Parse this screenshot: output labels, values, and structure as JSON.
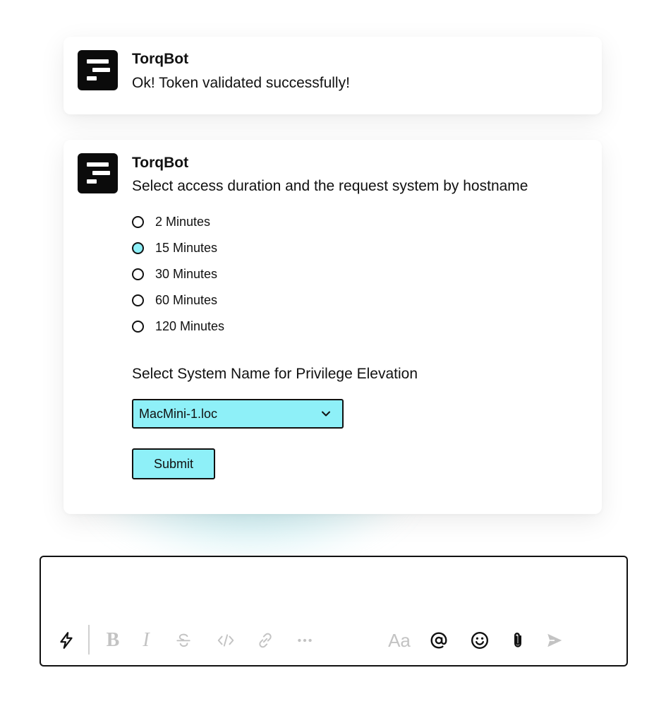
{
  "messages": [
    {
      "sender": "TorqBot",
      "text": "Ok! Token validated successfully!"
    },
    {
      "sender": "TorqBot",
      "text": "Select access duration and the request system by hostname"
    }
  ],
  "duration_options": [
    "2 Minutes",
    "15 Minutes",
    "30 Minutes",
    "60 Minutes",
    "120 Minutes"
  ],
  "selected_duration": "15 Minutes",
  "system_label": "Select System Name for Privilege Elevation",
  "system_select_value": "MacMini-1.loc",
  "submit_label": "Submit",
  "composer": {
    "icons": [
      "lightning-icon",
      "bold-icon",
      "italic-icon",
      "strikethrough-icon",
      "code-icon",
      "link-icon",
      "more-icon",
      "text-format-icon",
      "mention-icon",
      "emoji-icon",
      "attachment-icon",
      "send-icon"
    ],
    "text_format_label": "Aa"
  },
  "colors": {
    "accent": "#8ef0f8",
    "muted_icon": "#c3c3c3",
    "dark": "#111111"
  }
}
